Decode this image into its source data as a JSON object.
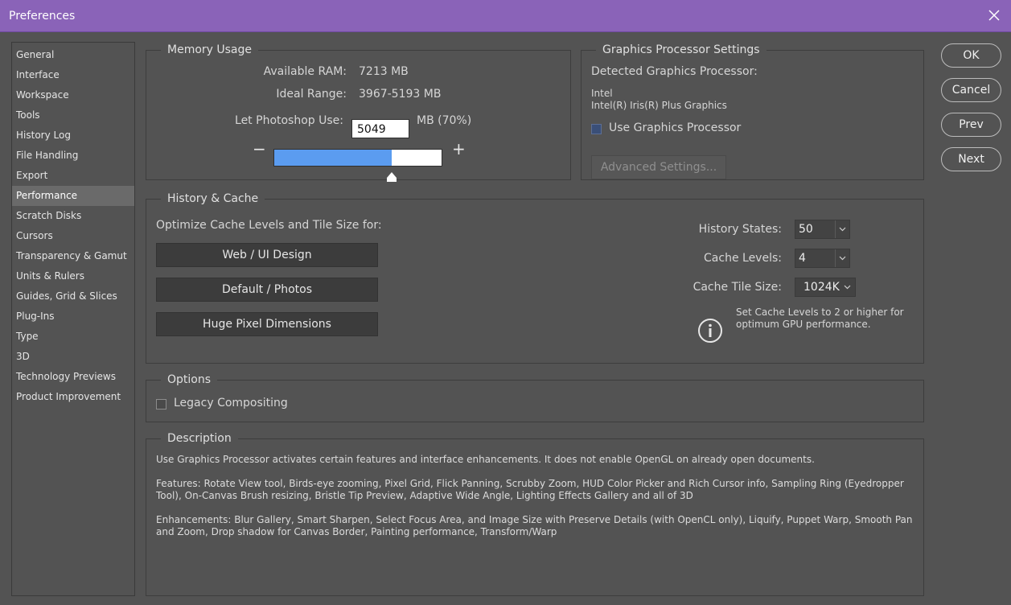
{
  "window": {
    "title": "Preferences"
  },
  "sidebar": {
    "items": [
      {
        "label": "General"
      },
      {
        "label": "Interface"
      },
      {
        "label": "Workspace"
      },
      {
        "label": "Tools"
      },
      {
        "label": "History Log"
      },
      {
        "label": "File Handling"
      },
      {
        "label": "Export"
      },
      {
        "label": "Performance",
        "selected": true
      },
      {
        "label": "Scratch Disks"
      },
      {
        "label": "Cursors"
      },
      {
        "label": "Transparency & Gamut"
      },
      {
        "label": "Units & Rulers"
      },
      {
        "label": "Guides, Grid & Slices"
      },
      {
        "label": "Plug-Ins"
      },
      {
        "label": "Type"
      },
      {
        "label": "3D"
      },
      {
        "label": "Technology Previews"
      },
      {
        "label": "Product Improvement"
      }
    ]
  },
  "memory": {
    "legend": "Memory Usage",
    "available_label": "Available RAM:",
    "available_value": "7213 MB",
    "ideal_label": "Ideal Range:",
    "ideal_value": "3967-5193 MB",
    "use_label": "Let Photoshop Use:",
    "use_value": "5049",
    "use_unit": "MB (70%)",
    "slider_fraction": 0.7,
    "minus": "−",
    "plus": "+"
  },
  "gpu": {
    "legend": "Graphics Processor Settings",
    "detected_label": "Detected Graphics Processor:",
    "vendor": "Intel",
    "model": "Intel(R) Iris(R) Plus Graphics",
    "use_label": "Use Graphics Processor",
    "advanced_label": "Advanced Settings..."
  },
  "history": {
    "legend": "History & Cache",
    "optimize_label": "Optimize Cache Levels and Tile Size for:",
    "buttons": [
      "Web / UI Design",
      "Default / Photos",
      "Huge Pixel Dimensions"
    ],
    "states_label": "History States:",
    "states_value": "50",
    "levels_label": "Cache Levels:",
    "levels_value": "4",
    "tile_label": "Cache Tile Size:",
    "tile_value": "1024K",
    "info_text_1": "Set Cache Levels to 2 or higher for",
    "info_text_2": "optimum GPU performance."
  },
  "options": {
    "legend": "Options",
    "legacy_label": "Legacy Compositing"
  },
  "description": {
    "legend": "Description",
    "p1": "Use Graphics Processor activates certain features and interface enhancements. It does not enable OpenGL on already open documents.",
    "p2": "Features: Rotate View tool, Birds-eye zooming, Pixel Grid, Flick Panning, Scrubby Zoom, HUD Color Picker and Rich Cursor info, Sampling Ring (Eyedropper Tool), On-Canvas Brush resizing, Bristle Tip Preview, Adaptive Wide Angle, Lighting Effects Gallery and all of 3D",
    "p3": "Enhancements: Blur Gallery, Smart Sharpen, Select Focus Area, and Image Size with Preserve Details (with OpenCL only), Liquify, Puppet Warp, Smooth Pan and Zoom, Drop shadow for Canvas Border, Painting performance, Transform/Warp"
  },
  "actions": {
    "ok": "OK",
    "cancel": "Cancel",
    "prev": "Prev",
    "next": "Next"
  },
  "colors": {
    "titlebar": "#8a63b8",
    "background": "#535353",
    "slider_fill": "#5b9cf0"
  }
}
